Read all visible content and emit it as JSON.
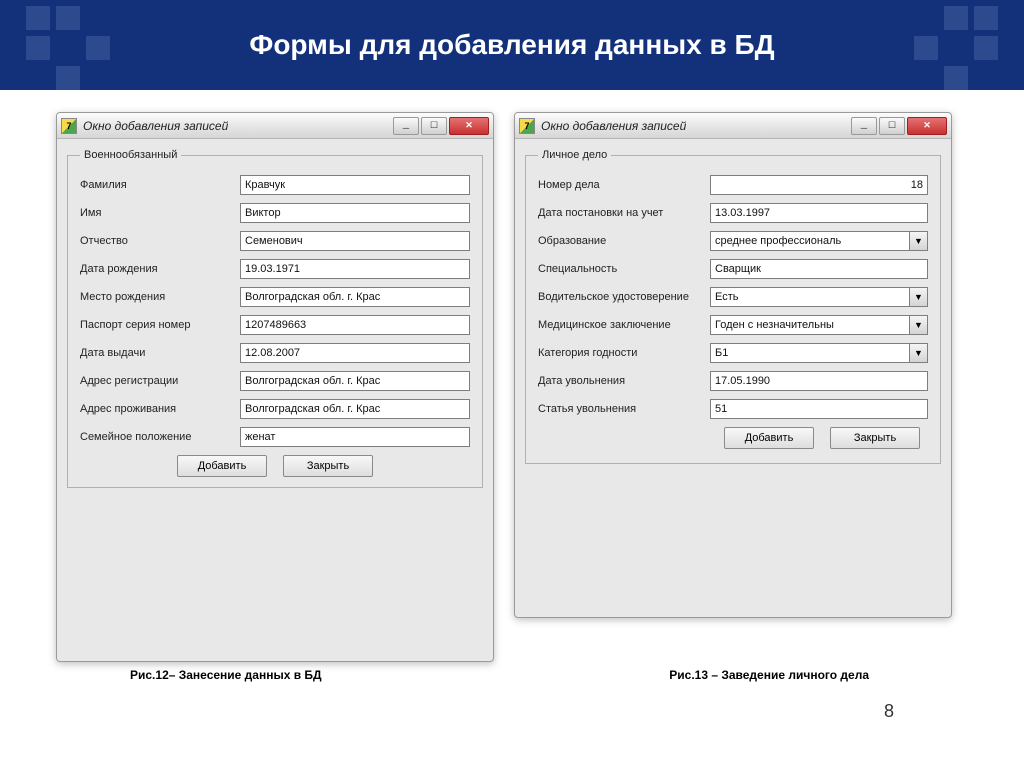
{
  "slide": {
    "title": "Формы для добавления данных в БД",
    "page_number": "8"
  },
  "captions": {
    "c1": "Рис.12– Занесение  данных в БД",
    "c2": "Рис.13 – Заведение личного дела"
  },
  "window1": {
    "title": "Окно добавления записей",
    "group_title": "Военнообязанный",
    "fields": {
      "surname_label": "Фамилия",
      "surname": "Кравчук",
      "name_label": "Имя",
      "name": "Виктор",
      "patronymic_label": "Отчество",
      "patronymic": "Семенович",
      "dob_label": "Дата рождения",
      "dob": "19.03.1971",
      "birthplace_label": "Место рождения",
      "birthplace": "Волгоградская обл. г. Крас",
      "passport_label": "Паспорт серия номер",
      "passport": "1207489663",
      "issue_date_label": "Дата выдачи",
      "issue_date": "12.08.2007",
      "reg_addr_label": "Адрес регистрации",
      "reg_addr": "Волгоградская обл. г. Крас",
      "live_addr_label": "Адрес проживания",
      "live_addr": "Волгоградская обл. г. Крас",
      "marital_label": "Семейное положение",
      "marital": "женат"
    },
    "buttons": {
      "add": "Добавить",
      "close": "Закрыть"
    }
  },
  "window2": {
    "title": "Окно добавления записей",
    "group_title": "Личное дело",
    "fields": {
      "case_no_label": "Номер дела",
      "case_no": "18",
      "reg_date_label": "Дата постановки на учет",
      "reg_date": "13.03.1997",
      "education_label": "Образование",
      "education": "среднее профессиональ",
      "specialty_label": "Специальность",
      "specialty": "Сварщик",
      "license_label": "Водительское удостоверение",
      "license": "Есть",
      "medical_label": "Медицинское заключение",
      "medical": "Годен с незначительны",
      "category_label": "Категория годности",
      "category": "Б1",
      "discharge_date_label": "Дата увольнения",
      "discharge_date": "17.05.1990",
      "discharge_art_label": "Статья увольнения",
      "discharge_art": "51"
    },
    "buttons": {
      "add": "Добавить",
      "close": "Закрыть"
    }
  }
}
